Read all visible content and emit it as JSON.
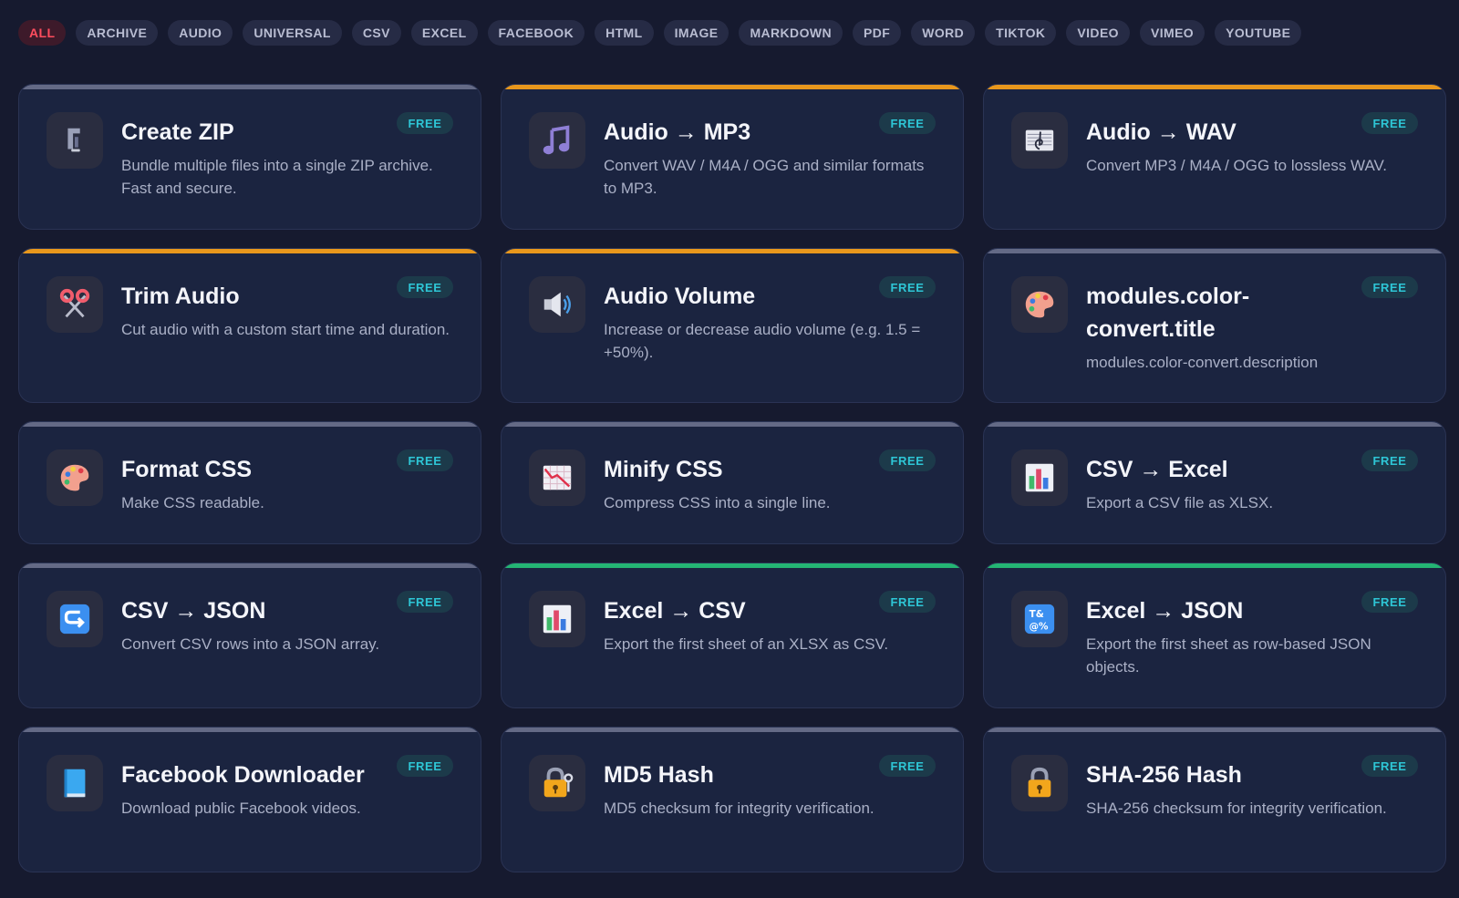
{
  "filters": [
    "ALL",
    "ARCHIVE",
    "AUDIO",
    "UNIVERSAL",
    "CSV",
    "EXCEL",
    "FACEBOOK",
    "HTML",
    "IMAGE",
    "MARKDOWN",
    "PDF",
    "WORD",
    "TIKTOK",
    "VIDEO",
    "VIMEO",
    "YOUTUBE"
  ],
  "active_filter": "ALL",
  "badge_label": "FREE",
  "colors": {
    "orange_accent": "#e8971c",
    "green_accent": "#24b574",
    "gray_accent": "#646a86",
    "badge_text": "#2ec6d6",
    "active_chip": "#ff4d5e"
  },
  "cards": [
    {
      "title": "Create ZIP",
      "desc": "Bundle multiple files into a single ZIP archive. Fast and secure.",
      "icon": "clamp-icon",
      "accent": "gray"
    },
    {
      "title": "Audio → MP3",
      "desc": "Convert WAV / M4A / OGG and similar formats to MP3.",
      "icon": "music-note-icon",
      "accent": "orange"
    },
    {
      "title": "Audio → WAV",
      "desc": "Convert MP3 / M4A / OGG to lossless WAV.",
      "icon": "musical-score-icon",
      "accent": "orange"
    },
    {
      "title": "Trim Audio",
      "desc": "Cut audio with a custom start time and duration.",
      "icon": "scissors-icon",
      "accent": "orange"
    },
    {
      "title": "Audio Volume",
      "desc": "Increase or decrease audio volume (e.g. 1.5 = +50%).",
      "icon": "speaker-icon",
      "accent": "orange"
    },
    {
      "title": "modules.color-convert.title",
      "desc": "modules.color-convert.description",
      "icon": "palette-icon",
      "accent": "gray"
    },
    {
      "title": "Format CSS",
      "desc": "Make CSS readable.",
      "icon": "palette-icon",
      "accent": "gray"
    },
    {
      "title": "Minify CSS",
      "desc": "Compress CSS into a single line.",
      "icon": "chart-decreasing-icon",
      "accent": "gray"
    },
    {
      "title": "CSV → Excel",
      "desc": "Export a CSV file as XLSX.",
      "icon": "bar-chart-icon",
      "accent": "gray"
    },
    {
      "title": "CSV → JSON",
      "desc": "Convert CSV rows into a JSON array.",
      "icon": "return-arrow-icon",
      "accent": "gray"
    },
    {
      "title": "Excel → CSV",
      "desc": "Export the first sheet of an XLSX as CSV.",
      "icon": "bar-chart-icon",
      "accent": "green"
    },
    {
      "title": "Excel → JSON",
      "desc": "Export the first sheet as row-based JSON objects.",
      "icon": "symbols-icon",
      "accent": "green"
    },
    {
      "title": "Facebook Downloader",
      "desc": "Download public Facebook videos.",
      "icon": "blue-book-icon",
      "accent": "gray"
    },
    {
      "title": "MD5 Hash",
      "desc": "MD5 checksum for integrity verification.",
      "icon": "lock-with-key-icon",
      "accent": "gray"
    },
    {
      "title": "SHA-256 Hash",
      "desc": "SHA-256 checksum for integrity verification.",
      "icon": "padlock-icon",
      "accent": "gray"
    }
  ]
}
